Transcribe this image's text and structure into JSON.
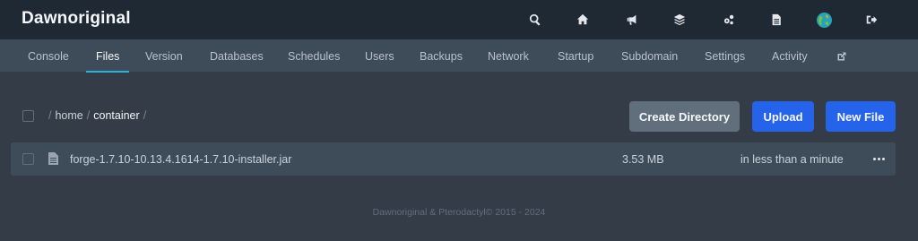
{
  "app": {
    "brand": "Dawnoriginal"
  },
  "topbar": {
    "icons": [
      "search-icon",
      "home-icon",
      "megaphone-icon",
      "layers-icon",
      "cogs-icon",
      "document-icon",
      "avatar",
      "sign-out-icon"
    ]
  },
  "tabs": [
    {
      "label": "Console",
      "active": false
    },
    {
      "label": "Files",
      "active": true
    },
    {
      "label": "Version",
      "active": false
    },
    {
      "label": "Databases",
      "active": false
    },
    {
      "label": "Schedules",
      "active": false
    },
    {
      "label": "Users",
      "active": false
    },
    {
      "label": "Backups",
      "active": false
    },
    {
      "label": "Network",
      "active": false
    },
    {
      "label": "Startup",
      "active": false
    },
    {
      "label": "Subdomain",
      "active": false
    },
    {
      "label": "Settings",
      "active": false
    },
    {
      "label": "Activity",
      "active": false
    }
  ],
  "breadcrumb": {
    "sep": "/",
    "segments": [
      "home",
      "container"
    ]
  },
  "actions": {
    "create_directory": "Create Directory",
    "upload": "Upload",
    "new_file": "New File"
  },
  "files": [
    {
      "name": "forge-1.7.10-10.13.4.1614-1.7.10-installer.jar",
      "size": "3.53 MB",
      "modified": "in less than a minute"
    }
  ],
  "footer": {
    "text": "Dawnoriginal & Pterodactyl© 2015 - 2024"
  },
  "colors": {
    "accent_tab": "#2bb0d8",
    "primary_button": "#2563eb",
    "secondary_button": "#616e7c",
    "topbar": "#1f2933",
    "background": "#333c47"
  }
}
